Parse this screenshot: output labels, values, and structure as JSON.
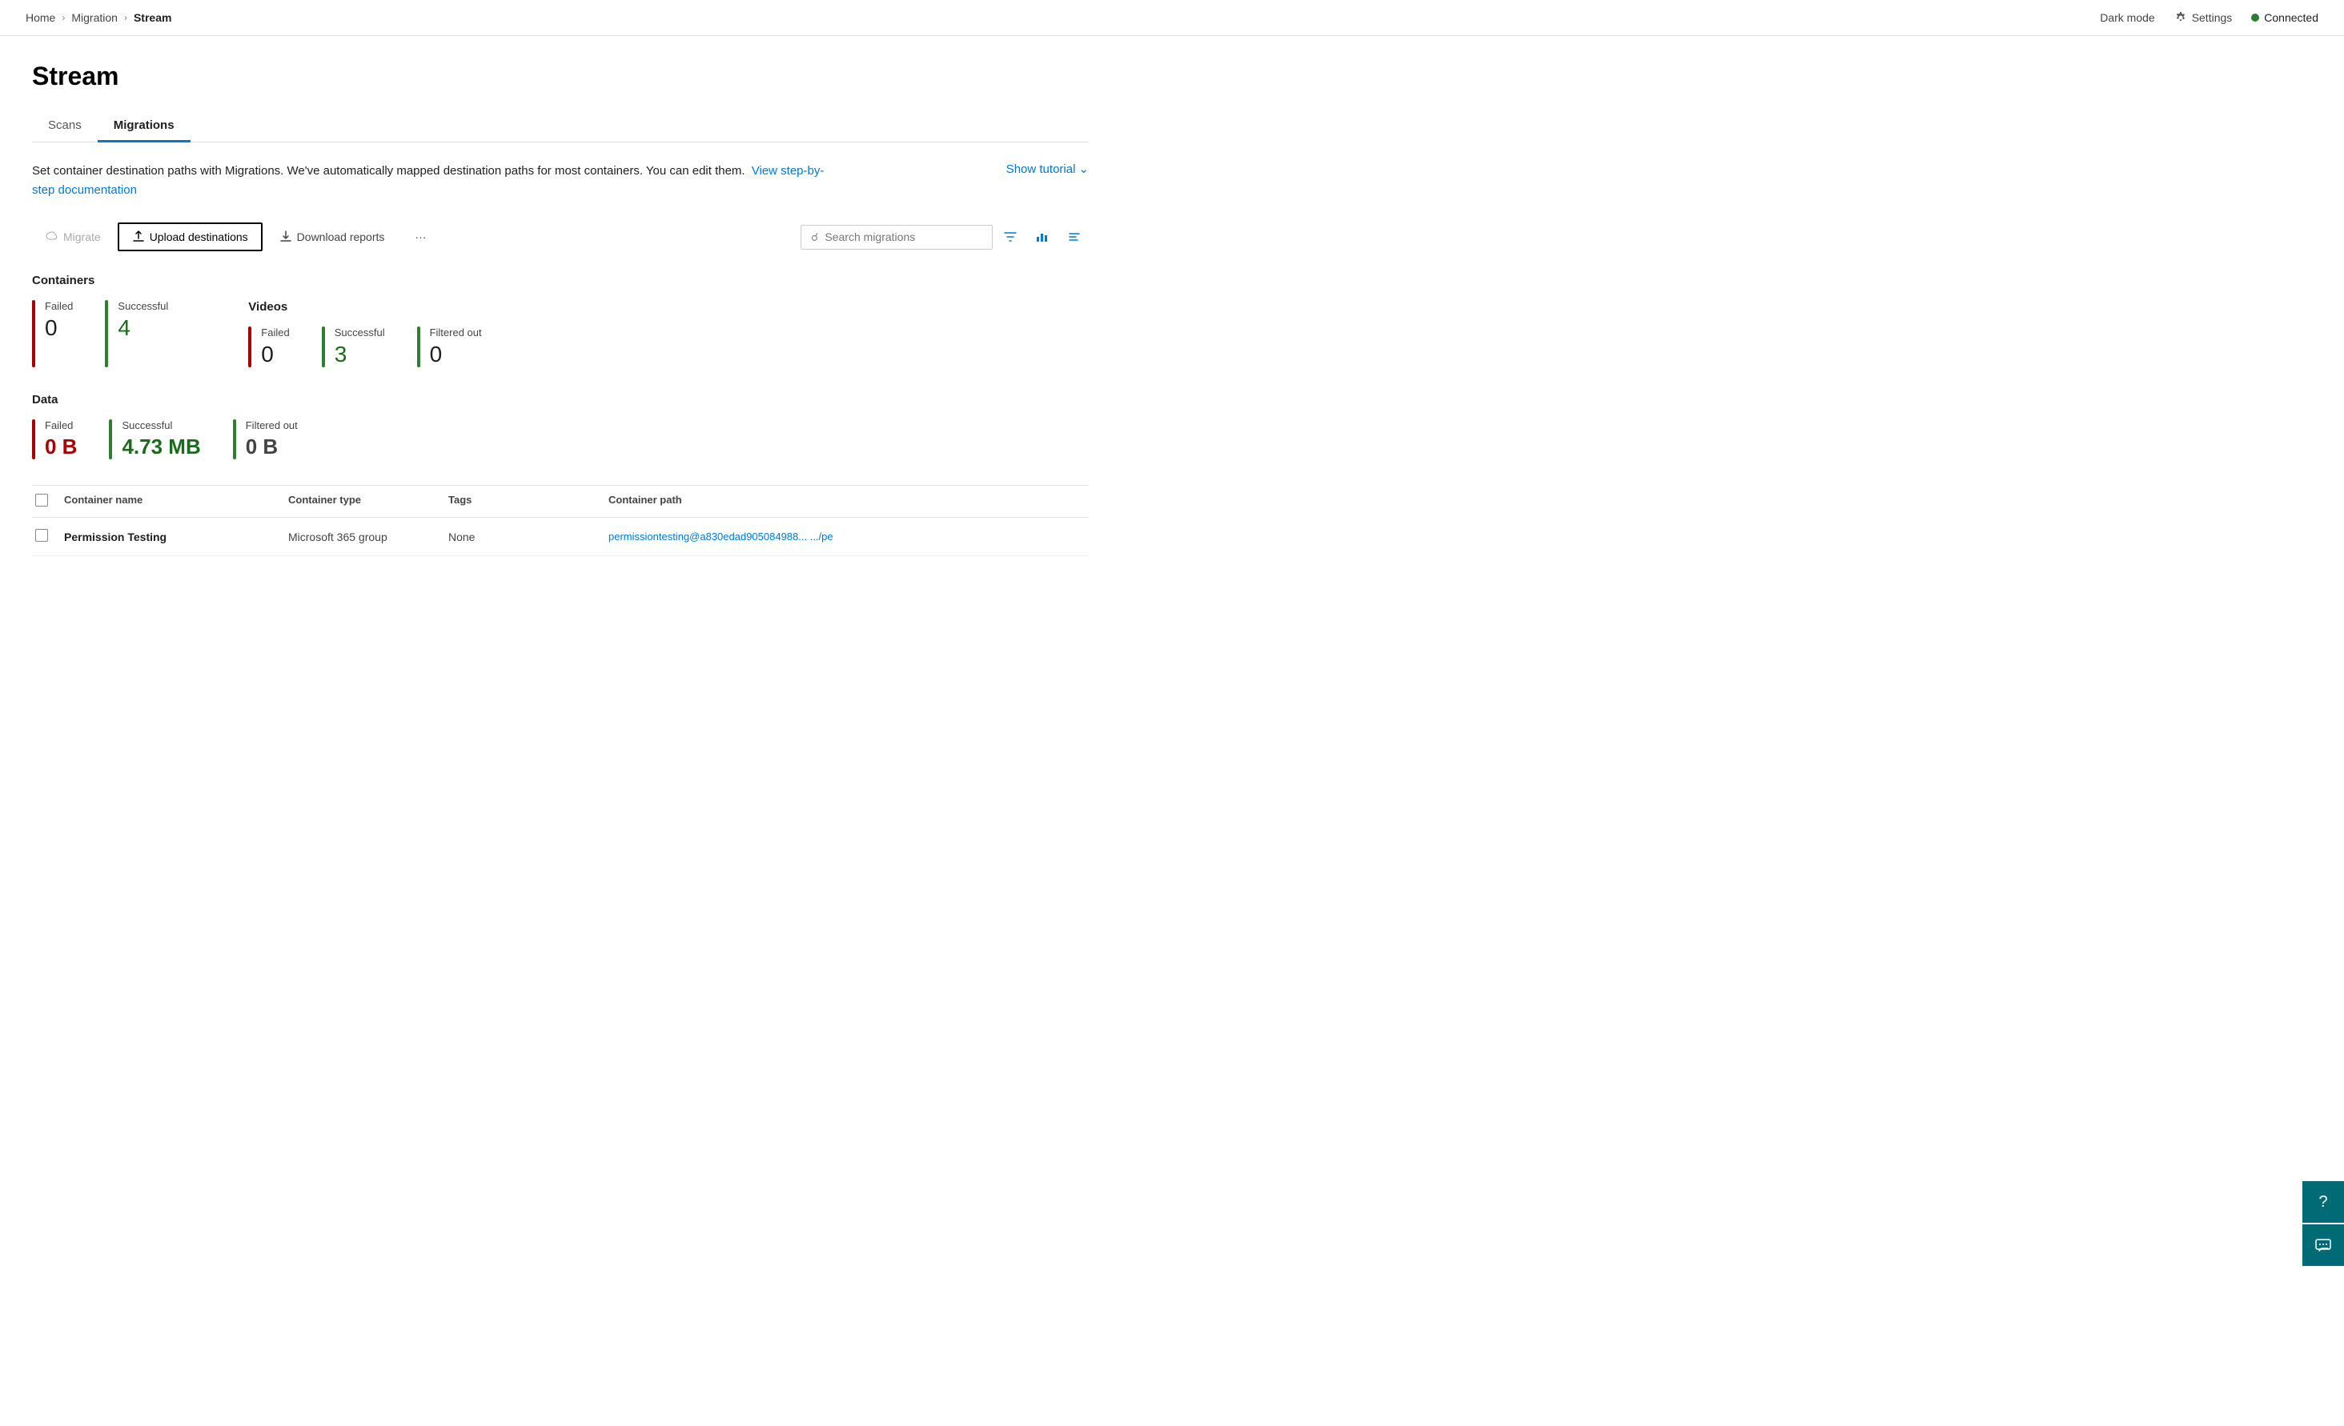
{
  "breadcrumb": {
    "home": "Home",
    "migration": "Migration",
    "current": "Stream",
    "sep1": "›",
    "sep2": "›"
  },
  "topbar": {
    "dark_mode": "Dark mode",
    "settings": "Settings",
    "connected": "Connected"
  },
  "page": {
    "title": "Stream"
  },
  "tabs": [
    {
      "id": "scans",
      "label": "Scans",
      "active": false
    },
    {
      "id": "migrations",
      "label": "Migrations",
      "active": true
    }
  ],
  "description": {
    "text1": "Set container destination paths with Migrations. We've automatically mapped destination paths for most containers. You can edit them.",
    "link_text": "View step-by-step documentation",
    "show_tutorial": "Show tutorial"
  },
  "toolbar": {
    "migrate": "Migrate",
    "upload_destinations": "Upload destinations",
    "download_reports": "Download reports",
    "more": "···",
    "search_placeholder": "Search migrations"
  },
  "stats": {
    "containers_title": "Containers",
    "containers": [
      {
        "label": "Failed",
        "value": "0",
        "type": "failed"
      },
      {
        "label": "Successful",
        "value": "4",
        "type": "success"
      }
    ],
    "videos": [
      {
        "label": "Failed",
        "value": "0",
        "type": "failed"
      },
      {
        "label": "Successful",
        "value": "3",
        "type": "success"
      },
      {
        "label": "Filtered out",
        "value": "0",
        "type": "filtered"
      }
    ],
    "videos_title": "Videos",
    "data_title": "Data",
    "data": [
      {
        "label": "Failed",
        "value": "0 B",
        "type": "red-bold"
      },
      {
        "label": "Successful",
        "value": "4.73 MB",
        "type": "green-bold"
      },
      {
        "label": "Filtered out",
        "value": "0 B",
        "type": "gray-bold"
      }
    ]
  },
  "table": {
    "headers": [
      "",
      "Container name",
      "Container type",
      "Tags",
      "Container path"
    ],
    "rows": [
      {
        "name": "Permission Testing",
        "type": "Microsoft 365 group",
        "tags": "None",
        "path": "permissiontesting@a830edad905084988...  .../pe"
      }
    ]
  }
}
